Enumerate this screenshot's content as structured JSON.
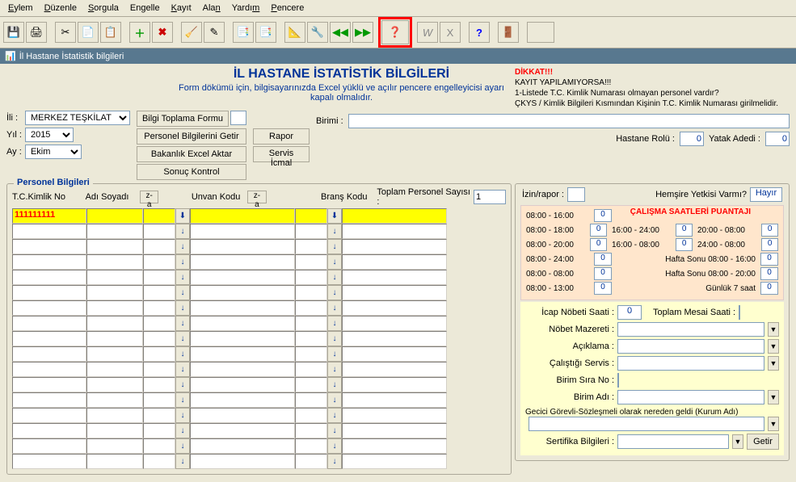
{
  "menu": [
    "Eylem",
    "Düzenle",
    "Sorgula",
    "Engelle",
    "Kayıt",
    "Alan",
    "Yardım",
    "Pencere"
  ],
  "window_title": "İl Hastane İstatistik bilgileri",
  "main_title": "İL HASTANE İSTATİSTİK BİLGİLERİ",
  "subtitle": "Form dökümü için, bilgisayarınızda Excel yüklü ve açılır pencere engelleyicisi ayarı kapalı olmalıdır.",
  "dikkat": {
    "header": "DİKKAT!!!",
    "line1": "KAYIT YAPILAMIYORSA!!!",
    "line2": "1-Listede T.C. Kimlik Numarası olmayan personel vardır?",
    "line3": "ÇKYS / Kimlik Bilgileri Kısmından Kişinin T.C. Kimlik Numarası girilmelidir."
  },
  "filters": {
    "ili_label": "İli :",
    "ili_value": "MERKEZ TEŞKİLAT",
    "yil_label": "Yıl :",
    "yil_value": "2015",
    "ay_label": "Ay :",
    "ay_value": "Ekim"
  },
  "buttons": {
    "bilgi_toplama": "Bilgi Toplama Formu",
    "personel_getir": "Personel Bilgilerini Getir",
    "bakanlik_aktar": "Bakanlık Excel Aktar",
    "sonuc_kontrol": "Sonuç Kontrol",
    "rapor": "Rapor",
    "servis_icmal": "Servis İcmal",
    "getir": "Getir"
  },
  "birimi_label": "Birimi :",
  "hastane_rolu": {
    "label": "Hastane Rolü :",
    "value": "0"
  },
  "yatak_adedi": {
    "label": "Yatak Adedi :",
    "value": "0"
  },
  "personel": {
    "legend": "Personel Bilgileri",
    "cols": {
      "tc": "T.C.Kimlik No",
      "adi": "Adı Soyadı",
      "unvan": "Unvan Kodu",
      "brans": "Branş Kodu"
    },
    "toplam_label": "Toplam Personel Sayısı :",
    "toplam_value": "1",
    "sort_btn": "z-a",
    "first_tc": "111111111"
  },
  "izin_rapor": "İzin/rapor :",
  "hemsire": {
    "label": "Hemşire Yetkisi Varmı?",
    "value": "Hayır"
  },
  "punt": {
    "title": "ÇALIŞMA SAATLERİ PUANTAJI",
    "rows_left": [
      "08:00 - 16:00",
      "08:00 - 18:00",
      "08:00 - 20:00",
      "08:00 - 24:00",
      "08:00 - 08:00",
      "08:00 - 13:00"
    ],
    "rows_right": [
      "16:00 - 24:00",
      "16:00 - 08:00",
      "Hafta Sonu 08:00 - 16:00",
      "Hafta Sonu 08:00 - 20:00",
      "Günlük 7 saat"
    ],
    "right_extra_first": "20:00 - 08:00",
    "right_extra_second": "24:00 - 08:00",
    "zero": "0"
  },
  "details": {
    "icap": "İcap Nöbeti Saati :",
    "icap_val": "0",
    "toplam_mesai": "Toplam Mesai Saati :",
    "nobet_mazereti": "Nöbet Mazereti :",
    "aciklama": "Açıklama :",
    "calistigi_servis": "Çalıştığı Servis :",
    "birim_sira": "Birim Sıra No :",
    "birim_adi": "Birim Adı :",
    "gecici": "Gecici Görevli-Sözleşmeli olarak nereden geldi (Kurum Adı)",
    "sertifika": "Sertifika Bilgileri :"
  }
}
